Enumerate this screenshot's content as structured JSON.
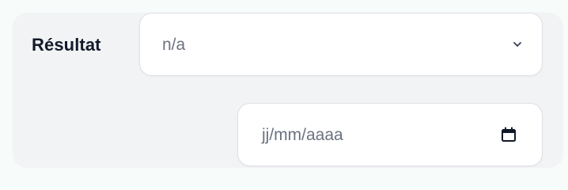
{
  "field": {
    "label": "Résultat"
  },
  "result_select": {
    "value": "n/a",
    "icon": "chevron-down-icon"
  },
  "date_input": {
    "placeholder": "jj/mm/aaaa",
    "icon": "calendar-icon"
  }
}
